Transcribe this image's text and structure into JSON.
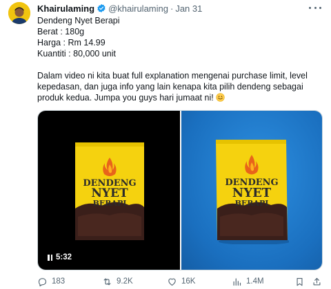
{
  "author": {
    "display_name": "Khairulaming",
    "handle": "@khairulaming",
    "separator": "·",
    "date": "Jan 31",
    "verified_color": "#1d9bf0",
    "avatar_bg": "#f1c40f"
  },
  "tweet": {
    "lines": [
      "Dendeng Nyet Berapi",
      "Berat : 180g",
      "Harga : Rm 14.99",
      "Kuantiti : 80,000 unit"
    ],
    "paragraph": "Dalam video ni kita buat full explanation mengenai purchase limit, level kepedasan, dan juga info yang lain kenapa kita pilih dendeng sebagai produk kedua. Jumpa you guys hari jumaat ni!",
    "emoji": "smiling-face-emoji"
  },
  "media": {
    "left_bg": "#000000",
    "right_bg": "#1f7fd0",
    "pouch_color": "#f5d20f",
    "product_text": [
      "DENDENG",
      "NYET",
      "BERAPI"
    ],
    "video_duration": "5:32"
  },
  "actions": {
    "replies": "183",
    "retweets": "9.2K",
    "likes": "16K",
    "views": "1.4M"
  },
  "icons": [
    "verified-icon",
    "more-icon",
    "pause-icon",
    "reply-icon",
    "retweet-icon",
    "like-icon",
    "views-icon",
    "bookmark-icon",
    "share-icon"
  ]
}
